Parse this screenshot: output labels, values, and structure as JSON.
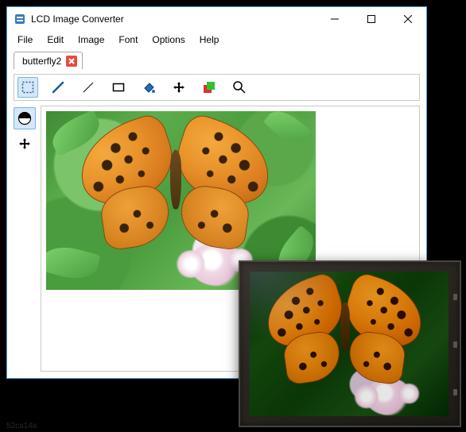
{
  "app": {
    "title": "LCD Image Converter",
    "icon_name": "app-icon"
  },
  "window_controls": {
    "minimize": "minimize",
    "maximize": "maximize",
    "close": "close"
  },
  "menubar": {
    "items": [
      "File",
      "Edit",
      "Image",
      "Font",
      "Options",
      "Help"
    ]
  },
  "tabs": [
    {
      "label": "butterfly2",
      "closable": true,
      "active": true
    }
  ],
  "toolbar": {
    "tools": [
      {
        "name": "select-rect-tool",
        "selected": true
      },
      {
        "name": "pencil-tool",
        "selected": false
      },
      {
        "name": "line-tool",
        "selected": false
      },
      {
        "name": "rectangle-tool",
        "selected": false
      },
      {
        "name": "fill-tool",
        "selected": false
      },
      {
        "name": "move-tool",
        "selected": false
      },
      {
        "name": "color-swap-tool",
        "selected": false
      },
      {
        "name": "zoom-tool",
        "selected": false
      }
    ]
  },
  "sidebar": {
    "tools": [
      {
        "name": "color-indicator",
        "selected": true
      },
      {
        "name": "pan-tool",
        "selected": false
      }
    ]
  },
  "canvas": {
    "image_name": "butterfly2",
    "description": "orange-butterfly-on-green-leaves"
  },
  "overlay": {
    "device": "lcd-display-module",
    "shows": "same-butterfly-image"
  },
  "status": {
    "code": "52ca14a"
  },
  "colors": {
    "window_border": "#4aa0e0",
    "selection_bg": "#d6e8f7",
    "selection_border": "#7ab3e0",
    "close_red": "#e74c3c"
  }
}
